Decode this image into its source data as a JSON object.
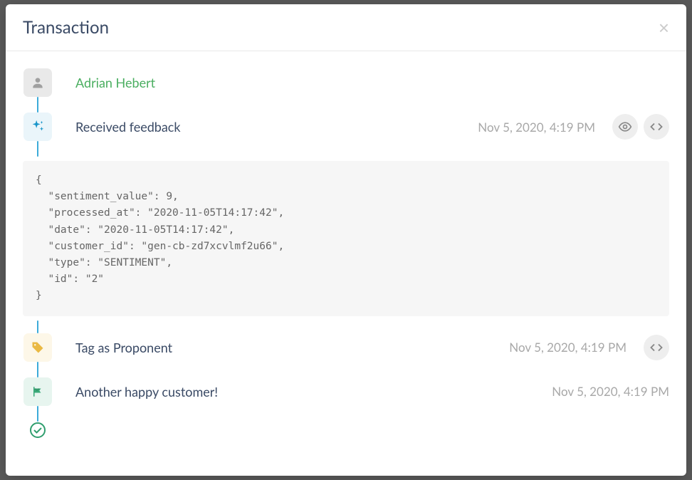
{
  "modal": {
    "title": "Transaction"
  },
  "customer": {
    "name": "Adrian Hebert"
  },
  "events": {
    "feedback": {
      "label": "Received feedback",
      "timestamp": "Nov 5, 2020, 4:19 PM"
    },
    "tag": {
      "label": "Tag as Proponent",
      "timestamp": "Nov 5, 2020, 4:19 PM"
    },
    "goal": {
      "label": "Another happy customer!",
      "timestamp": "Nov 5, 2020, 4:19 PM"
    }
  },
  "payload": "{\n  \"sentiment_value\": 9,\n  \"processed_at\": \"2020-11-05T14:17:42\",\n  \"date\": \"2020-11-05T14:17:42\",\n  \"customer_id\": \"gen-cb-zd7xcvlmf2u66\",\n  \"type\": \"SENTIMENT\",\n  \"id\": \"2\"\n}"
}
